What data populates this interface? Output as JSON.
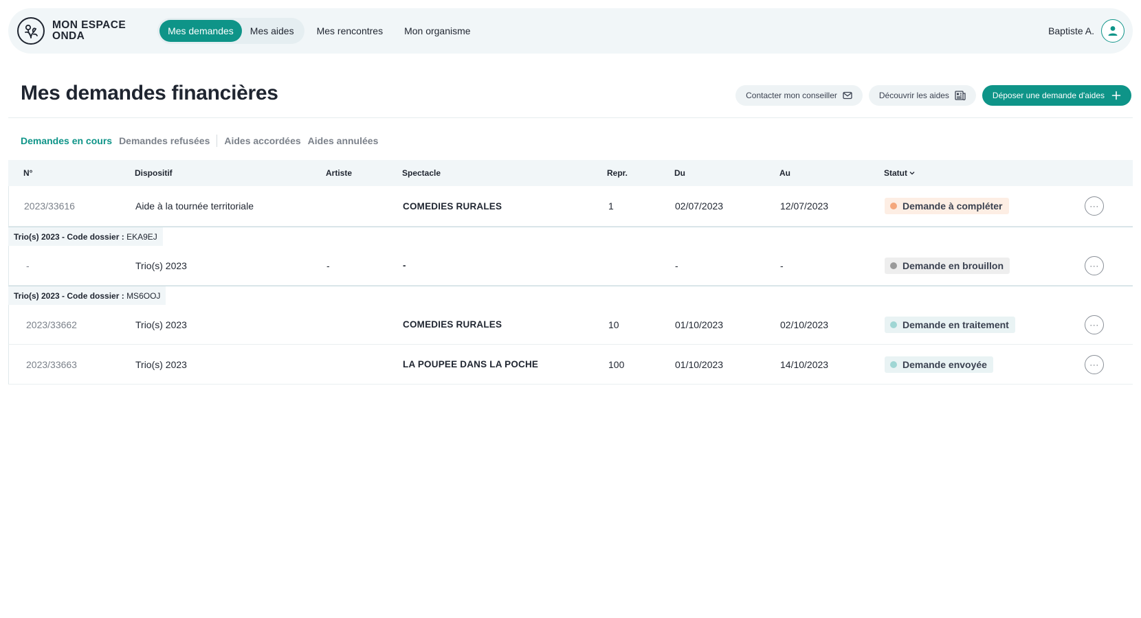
{
  "app": {
    "logo_line1": "MON ESPACE",
    "logo_line2": "ONDA",
    "nav_tabs": [
      "Mes demandes",
      "Mes aides",
      "Mes rencontres",
      "Mon organisme"
    ],
    "user_name": "Baptiste A."
  },
  "header": {
    "title": "Mes demandes financières",
    "contact_label": "Contacter mon conseiller",
    "discover_label": "Découvrir les aides",
    "deposit_label": "Déposer une demande d'aides"
  },
  "tabs": [
    "Demandes en cours",
    "Demandes refusées",
    "Aides accordées",
    "Aides annulées"
  ],
  "table": {
    "columns": [
      "N°",
      "Dispositif",
      "Artiste",
      "Spectacle",
      "Repr.",
      "Du",
      "Au",
      "Statut"
    ],
    "rows": [
      {
        "num": "2023/33616",
        "dispositif": "Aide à la tournée territoriale",
        "artiste": "",
        "spectacle": "COMEDIES RURALES",
        "repr": "1",
        "du": "02/07/2023",
        "au": "12/07/2023",
        "statut": "Demande à compléter"
      },
      {
        "num": "-",
        "dispositif": "Trio(s) 2023",
        "artiste": "-",
        "spectacle": "-",
        "repr": "",
        "du": "-",
        "au": "-",
        "statut": "Demande en brouillon"
      },
      {
        "num": "2023/33662",
        "dispositif": "Trio(s) 2023",
        "artiste": "",
        "spectacle": "COMEDIES RURALES",
        "repr": "10",
        "du": "01/10/2023",
        "au": "02/10/2023",
        "statut": "Demande en traitement"
      },
      {
        "num": "2023/33663",
        "dispositif": "Trio(s) 2023",
        "artiste": "",
        "spectacle": "LA POUPEE DANS LA POCHE",
        "repr": "100",
        "du": "01/10/2023",
        "au": "14/10/2023",
        "statut": "Demande envoyée"
      }
    ],
    "groups": [
      {
        "prefix": "Trio(s) 2023 - Code dossier :",
        "code": "EKA9EJ"
      },
      {
        "prefix": "Trio(s) 2023 - Code dossier :",
        "code": "MS6OOJ"
      }
    ],
    "more_glyph": "···"
  },
  "colors": {
    "accent": "#0e9488",
    "status_complete_bg": "#fdeee4",
    "status_complete_dot": "#f4a77c",
    "status_draft_bg": "#eeeeee",
    "status_draft_dot": "#9a9a9a",
    "status_process_bg": "#e9f3f4",
    "status_process_dot": "#9fd6d4",
    "status_sent_bg": "#e9f3f4",
    "status_sent_dot": "#9fd6d4"
  }
}
